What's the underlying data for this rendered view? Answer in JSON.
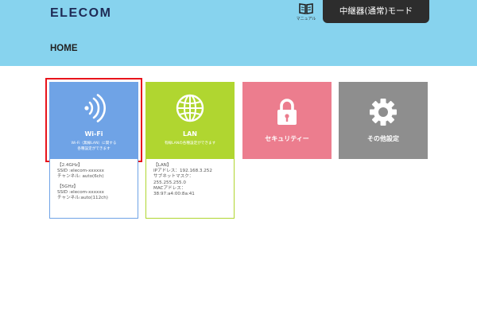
{
  "header": {
    "logo": "ELECOM",
    "manual_label": "マニュアル",
    "mode_button": "中継器(通常)モード"
  },
  "page": {
    "title": "HOME"
  },
  "tiles": [
    {
      "label": "Wi-Fi",
      "sub": [
        "Wi-Fi（無線LAN）に関する",
        "各種設定ができます"
      ],
      "color": "#6fa3e6",
      "icon": "wifi-icon",
      "selected": true
    },
    {
      "label": "LAN",
      "sub": [
        "有線LANの各種設定ができます"
      ],
      "color": "#b0d630",
      "icon": "globe-icon"
    },
    {
      "label": "セキュリティー",
      "color": "#ec7d8e",
      "icon": "lock-icon"
    },
    {
      "label": "その他設定",
      "color": "#8e8e8e",
      "icon": "gear-icon"
    }
  ],
  "wifi_info": {
    "band1_heading": "【2.4GHz】",
    "band1_ssid": "SSID :elecom-xxxxxx",
    "band1_channel": "チャンネル: auto(6ch)",
    "band2_heading": "【5GHz】",
    "band2_ssid": "SSID :elecom-xxxxxx",
    "band2_channel": "チャンネル:auto(112ch)"
  },
  "lan_info": {
    "heading": "【LAN】",
    "ip": "IPアドレス：192.168.3.252",
    "subnet_label": "サブネットマスク：",
    "subnet_value": "255.255.255.0",
    "mac_label": "MACアドレス：",
    "mac_value": "38:97:a4:00:8a:41"
  }
}
